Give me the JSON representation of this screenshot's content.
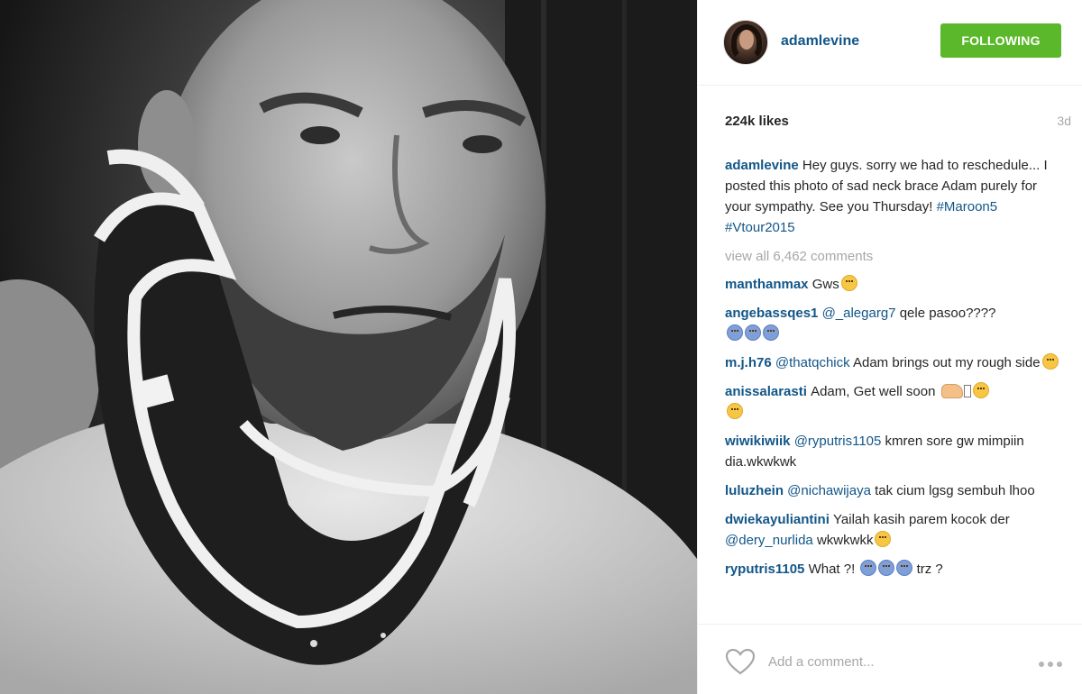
{
  "post": {
    "username": "adamlevine",
    "follow_label": "FOLLOWING",
    "likes": "224k likes",
    "age": "3d",
    "caption": {
      "user": "adamlevine",
      "text": "Hey guys. sorry we had to reschedule... I posted this photo of sad neck brace Adam purely for your sympathy. See you Thursday! ",
      "hashtags": "#Maroon5 #Vtour2015"
    },
    "view_all": "view all 6,462 comments",
    "comments": [
      {
        "user": "manthanmax",
        "text": "Gws"
      },
      {
        "user": "angebassqes1",
        "tag": "@_alegarg7",
        "text": "qele pasoo????"
      },
      {
        "user": "m.j.h76",
        "tag": "@thatqchick",
        "text": "Adam brings out my rough side"
      },
      {
        "user": "anissalarasti",
        "text": "Adam, Get well soon"
      },
      {
        "user": "wiwikiwiik",
        "tag": "@ryputris1105",
        "text": "kmren sore gw mimpiin dia.wkwkwk"
      },
      {
        "user": "luluzhein",
        "tag": "@nichawijaya",
        "text": "tak cium lgsg sembuh lhoo"
      },
      {
        "user": "dwiekayuliantini",
        "text": "Yailah kasih parem kocok der",
        "tag": "@dery_nurlida",
        "text2": "wkwkwkk"
      },
      {
        "user": "ryputris1105",
        "text": "What ?!",
        "text2": "trz ?"
      }
    ],
    "add_comment_placeholder": "Add a comment...",
    "icons": {
      "like": "heart-icon",
      "more": "more-icon",
      "avatar": "avatar"
    },
    "colors": {
      "username_blue": "#125688",
      "follow_green": "#5cb82b",
      "muted_gray": "#a5a7aa"
    }
  }
}
